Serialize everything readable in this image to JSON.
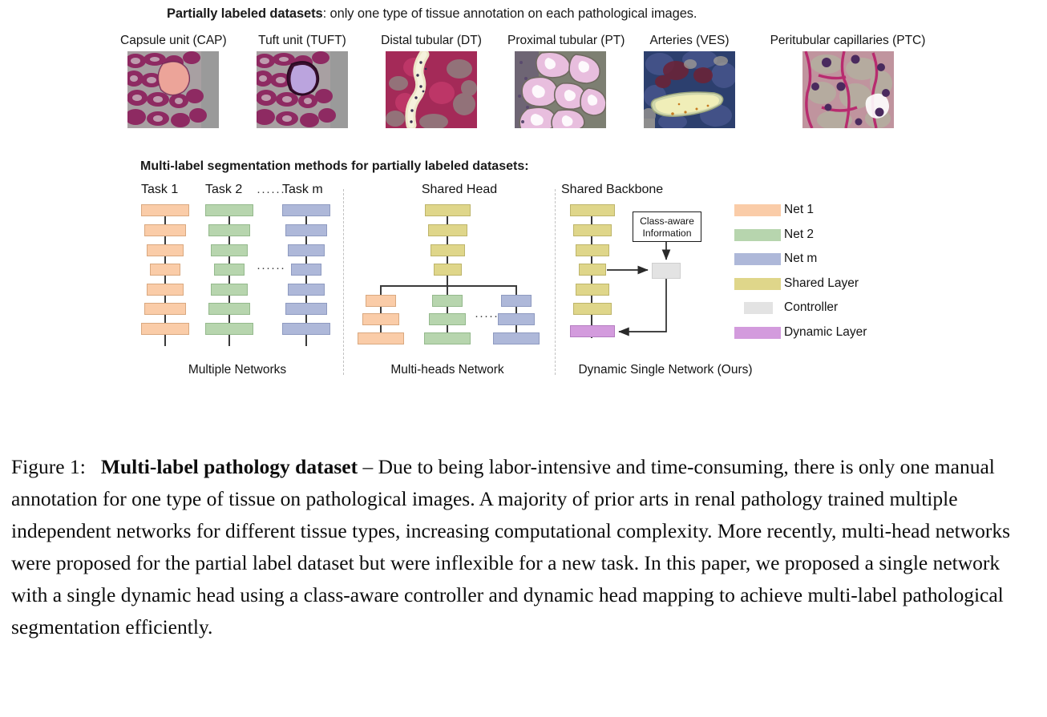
{
  "top_heading": {
    "bold": "Partially labeled datasets",
    "rest": ": only one type of tissue annotation on each pathological images."
  },
  "thumbnails": [
    {
      "label": "Capsule unit (CAP)",
      "icon": "pathology-thumbnail-cap"
    },
    {
      "label": "Tuft unit (TUFT)",
      "icon": "pathology-thumbnail-tuft"
    },
    {
      "label": "Distal tubular (DT)",
      "icon": "pathology-thumbnail-dt"
    },
    {
      "label": "Proximal tubular (PT)",
      "icon": "pathology-thumbnail-pt"
    },
    {
      "label": "Arteries (VES)",
      "icon": "pathology-thumbnail-ves"
    },
    {
      "label": "Peritubular capillaries (PTC)",
      "icon": "pathology-thumbnail-ptc"
    }
  ],
  "methods_heading": "Multi-label segmentation methods for partially labeled datasets:",
  "panels": {
    "multiple_networks": {
      "caption": "Multiple Networks",
      "task_labels": [
        "Task 1",
        "Task 2",
        "Task m"
      ],
      "task_dots": "······",
      "middle_dots": "······"
    },
    "multi_heads": {
      "title": "Shared Head",
      "caption": "Multi-heads Network",
      "branch_dots": "······"
    },
    "dynamic_single": {
      "title": "Shared Backbone",
      "caption": "Dynamic Single Network (Ours)",
      "class_aware_box": "Class-aware\nInformation",
      "class_aware_line1": "Class-aware",
      "class_aware_line2": "Information"
    }
  },
  "legend": [
    {
      "label": "Net 1",
      "color": "#FACCA8",
      "width": 58
    },
    {
      "label": "Net 2",
      "color": "#B7D5AE",
      "width": 58
    },
    {
      "label": "Net m",
      "color": "#AEB8D9",
      "width": 58
    },
    {
      "label": "Shared Layer",
      "color": "#DFD68A",
      "width": 58
    },
    {
      "label": "Controller",
      "color": "#E3E3E3",
      "width": 36
    },
    {
      "label": "Dynamic Layer",
      "color": "#D39BDD",
      "width": 58
    }
  ],
  "colors": {
    "net1_orange": "#FACCA8",
    "net2_green": "#B7D5AE",
    "netm_blue": "#AEB8D9",
    "shared_yellow": "#DFD68A",
    "controller_gray": "#E3E3E3",
    "dynamic_purple": "#D39BDD"
  },
  "caption": {
    "figure_label": "Figure 1:",
    "bold_title": "Multi-label pathology dataset",
    "body": " – Due to being labor-intensive and time-consuming, there is only one manual annotation for one type of tissue on pathological images. A majority of prior arts in renal pathology trained multiple independent networks for different tissue types, increasing computational complexity. More recently, multi-head networks were proposed for the partial label dataset but were inflexible for a new task. In this paper, we proposed a single network with a single dynamic head using a class-aware controller and dynamic head mapping to achieve multi-label pathological segmentation efficiently."
  }
}
